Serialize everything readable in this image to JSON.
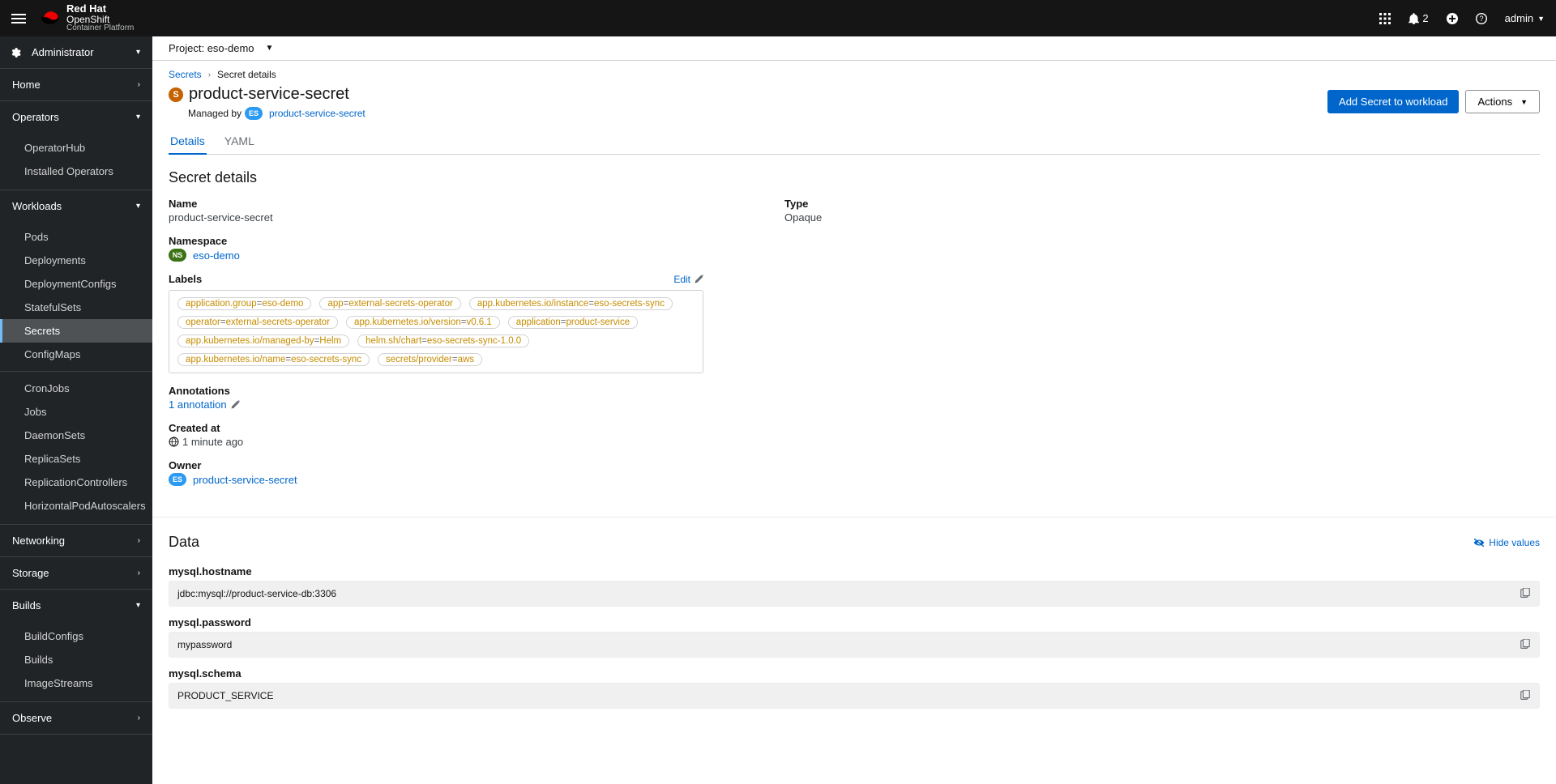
{
  "topbar": {
    "brand": {
      "vendor": "Red Hat",
      "product": "OpenShift",
      "subtitle": "Container Platform"
    },
    "notification_count": "2",
    "username": "admin"
  },
  "sidebar": {
    "perspective": "Administrator",
    "sections": [
      {
        "title": "Home",
        "expanded": false,
        "items": []
      },
      {
        "title": "Operators",
        "expanded": true,
        "items": [
          "OperatorHub",
          "Installed Operators"
        ]
      },
      {
        "title": "Workloads",
        "expanded": true,
        "items": [
          "Pods",
          "Deployments",
          "DeploymentConfigs",
          "StatefulSets",
          "Secrets",
          "ConfigMaps",
          "CronJobs",
          "Jobs",
          "DaemonSets",
          "ReplicaSets",
          "ReplicationControllers",
          "HorizontalPodAutoscalers"
        ],
        "active": "Secrets"
      },
      {
        "title": "Networking",
        "expanded": false,
        "items": []
      },
      {
        "title": "Storage",
        "expanded": false,
        "items": []
      },
      {
        "title": "Builds",
        "expanded": true,
        "items": [
          "BuildConfigs",
          "Builds",
          "ImageStreams"
        ]
      },
      {
        "title": "Observe",
        "expanded": false,
        "items": []
      }
    ]
  },
  "project_bar": {
    "prefix": "Project:",
    "name": "eso-demo"
  },
  "breadcrumbs": {
    "parent": "Secrets",
    "current": "Secret details"
  },
  "page": {
    "title": "product-service-secret",
    "managed_by_prefix": "Managed by",
    "managed_by_badge": "ES",
    "managed_by_name": "product-service-secret",
    "btn_add": "Add Secret to workload",
    "btn_actions": "Actions"
  },
  "tabs": [
    "Details",
    "YAML"
  ],
  "section_title": "Secret details",
  "details": {
    "labels": {
      "name": "Name",
      "namespace": "Namespace",
      "labels": "Labels",
      "annotations": "Annotations",
      "created_at": "Created at",
      "owner": "Owner",
      "type": "Type",
      "edit": "Edit",
      "annotation_link": "1 annotation"
    },
    "name": "product-service-secret",
    "namespace": "eso-demo",
    "namespace_badge": "NS",
    "type": "Opaque",
    "created_at": "1 minute ago",
    "owner_badge": "ES",
    "owner_name": "product-service-secret",
    "label_list": [
      {
        "k": "application.group",
        "v": "eso-demo"
      },
      {
        "k": "app",
        "v": "external-secrets-operator"
      },
      {
        "k": "app.kubernetes.io/instance",
        "v": "eso-secrets-sync"
      },
      {
        "k": "operator",
        "v": "external-secrets-operator"
      },
      {
        "k": "app.kubernetes.io/version",
        "v": "v0.6.1"
      },
      {
        "k": "application",
        "v": "product-service"
      },
      {
        "k": "app.kubernetes.io/managed-by",
        "v": "Helm"
      },
      {
        "k": "helm.sh/chart",
        "v": "eso-secrets-sync-1.0.0"
      },
      {
        "k": "app.kubernetes.io/name",
        "v": "eso-secrets-sync"
      },
      {
        "k": "secrets/provider",
        "v": "aws"
      }
    ]
  },
  "data": {
    "heading": "Data",
    "hide_values": "Hide values",
    "entries": [
      {
        "key": "mysql.hostname",
        "value": "jdbc:mysql://product-service-db:3306"
      },
      {
        "key": "mysql.password",
        "value": "mypassword"
      },
      {
        "key": "mysql.schema",
        "value": "PRODUCT_SERVICE"
      }
    ]
  }
}
